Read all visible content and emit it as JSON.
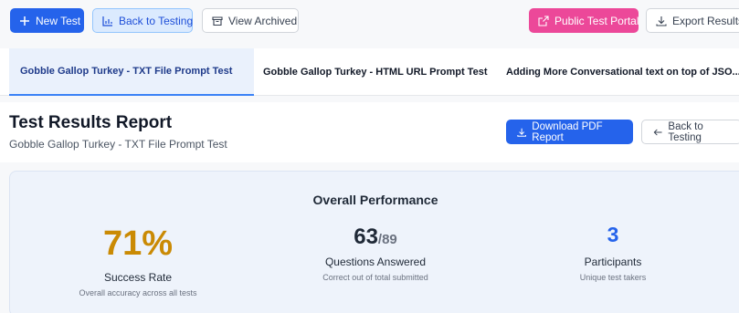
{
  "toolbar": {
    "new_test": "New Test",
    "back_to_testing": "Back to Testing",
    "view_archived": "View Archived",
    "public_portal": "Public Test Portal",
    "export_results": "Export Results"
  },
  "tabs": [
    {
      "label": "Gobble Gallop Turkey - TXT File Prompt Test",
      "active": true
    },
    {
      "label": "Gobble Gallop Turkey - HTML URL Prompt Test",
      "active": false
    },
    {
      "label": "Adding More Conversational text on top of JSO...",
      "active": false
    }
  ],
  "report": {
    "title": "Test Results Report",
    "subtitle": "Gobble Gallop Turkey - TXT File Prompt Test",
    "download_pdf": "Download PDF Report",
    "back_to_testing": "Back to Testing"
  },
  "performance": {
    "title": "Overall Performance",
    "success_rate": {
      "value": "71%",
      "label": "Success Rate",
      "desc": "Overall accuracy across all tests"
    },
    "questions": {
      "value": "63",
      "denom": "/89",
      "label": "Questions Answered",
      "desc": "Correct out of total submitted"
    },
    "participants": {
      "value": "3",
      "label": "Participants",
      "desc": "Unique test takers"
    }
  },
  "colors": {
    "primary": "#2563eb",
    "pink": "#ec4899",
    "success": "#ca8a04"
  }
}
